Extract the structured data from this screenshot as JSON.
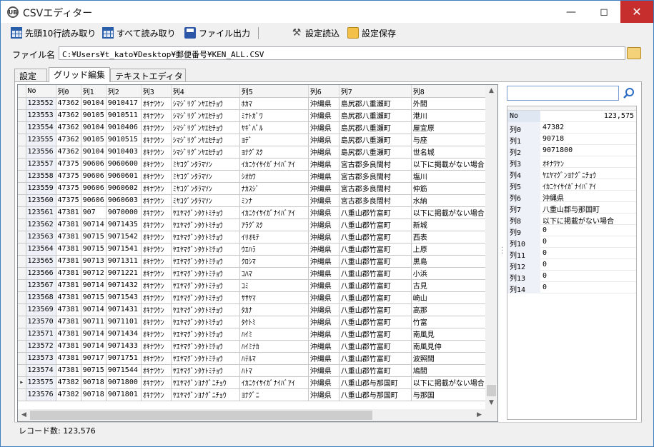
{
  "window": {
    "title": "CSVエディター",
    "icon_text": "UB"
  },
  "toolbar": {
    "read_head_label": "先頭10行読み取り",
    "read_all_label": "すべて読み取り",
    "file_output_label": "ファイル出力",
    "load_settings_label": "設定読込",
    "save_settings_label": "設定保存"
  },
  "file": {
    "label": "ファイル名",
    "path": "C:¥Users¥t_kato¥Desktop¥郵便番号¥KEN_ALL.CSV"
  },
  "tabs": [
    {
      "label": "設定",
      "active": false
    },
    {
      "label": "グリッド編集",
      "active": true
    },
    {
      "label": "テキストエディタ",
      "active": false
    }
  ],
  "grid": {
    "columns": [
      "No",
      "列0",
      "列1",
      "列2",
      "列3",
      "列4",
      "列5",
      "列6",
      "列7",
      "列8"
    ],
    "rows": [
      [
        "123552",
        "47362",
        "90104",
        "9010417",
        "ｵｷﾅﾜｹﾝ",
        "ｼﾏｼﾞﾘｸﾞﾝﾔｴｾﾁｮｳ",
        "ﾎｶﾏ",
        "沖縄県",
        "島尻郡八重瀬町",
        "外間"
      ],
      [
        "123553",
        "47362",
        "90105",
        "9010511",
        "ｵｷﾅﾜｹﾝ",
        "ｼﾏｼﾞﾘｸﾞﾝﾔｴｾﾁｮｳ",
        "ﾐﾅﾄｶﾞﾜ",
        "沖縄県",
        "島尻郡八重瀬町",
        "港川"
      ],
      [
        "123554",
        "47362",
        "90104",
        "9010406",
        "ｵｷﾅﾜｹﾝ",
        "ｼﾏｼﾞﾘｸﾞﾝﾔｴｾﾁｮｳ",
        "ﾔｷﾞﾊﾞﾙ",
        "沖縄県",
        "島尻郡八重瀬町",
        "屋宜原"
      ],
      [
        "123555",
        "47362",
        "90105",
        "9010515",
        "ｵｷﾅﾜｹﾝ",
        "ｼﾏｼﾞﾘｸﾞﾝﾔｴｾﾁｮｳ",
        "ﾖﾃﾞ",
        "沖縄県",
        "島尻郡八重瀬町",
        "与座"
      ],
      [
        "123556",
        "47362",
        "90104",
        "9010403",
        "ｵｷﾅﾜｹﾝ",
        "ｼﾏｼﾞﾘｸﾞﾝﾔｴｾﾁｮｳ",
        "ﾖﾅｸﾞｽｸ",
        "沖縄県",
        "島尻郡八重瀬町",
        "世名城"
      ],
      [
        "123557",
        "47375",
        "90606",
        "9060600",
        "ｵｷﾅﾜｹﾝ",
        "ﾐﾔｺｸﾞﾝﾀﾗﾏｿﾝ",
        "ｲｶﾆｹｲｻｲｶﾞﾅｲﾊﾞｱｲ",
        "沖縄県",
        "宮古郡多良間村",
        "以下に掲載がない場合"
      ],
      [
        "123558",
        "47375",
        "90606",
        "9060601",
        "ｵｷﾅﾜｹﾝ",
        "ﾐﾔｺｸﾞﾝﾀﾗﾏｿﾝ",
        "ｼｵｶﾜ",
        "沖縄県",
        "宮古郡多良間村",
        "塩川"
      ],
      [
        "123559",
        "47375",
        "90606",
        "9060602",
        "ｵｷﾅﾜｹﾝ",
        "ﾐﾔｺｸﾞﾝﾀﾗﾏｿﾝ",
        "ﾅｶｽｼﾞ",
        "沖縄県",
        "宮古郡多良間村",
        "仲筋"
      ],
      [
        "123560",
        "47375",
        "90606",
        "9060603",
        "ｵｷﾅﾜｹﾝ",
        "ﾐﾔｺｸﾞﾝﾀﾗﾏｿﾝ",
        "ﾐﾝﾅ",
        "沖縄県",
        "宮古郡多良間村",
        "水納"
      ],
      [
        "123561",
        "47381",
        "907",
        "9070000",
        "ｵｷﾅﾜｹﾝ",
        "ﾔｴﾔﾏｸﾞﾝﾀｹﾄﾐﾁｮｳ",
        "ｲｶﾆｹｲｻｲｶﾞﾅｲﾊﾞｱｲ",
        "沖縄県",
        "八重山郡竹富町",
        "以下に掲載がない場合"
      ],
      [
        "123562",
        "47381",
        "90714",
        "9071435",
        "ｵｷﾅﾜｹﾝ",
        "ﾔｴﾔﾏｸﾞﾝﾀｹﾄﾐﾁｮｳ",
        "ｱﾗｸﾞｽｸ",
        "沖縄県",
        "八重山郡竹富町",
        "新城"
      ],
      [
        "123563",
        "47381",
        "90715",
        "9071542",
        "ｵｷﾅﾜｹﾝ",
        "ﾔｴﾔﾏｸﾞﾝﾀｹﾄﾐﾁｮｳ",
        "ｲﾘｵﾓﾃ",
        "沖縄県",
        "八重山郡竹富町",
        "西表"
      ],
      [
        "123564",
        "47381",
        "90715",
        "9071541",
        "ｵｷﾅﾜｹﾝ",
        "ﾔｴﾔﾏｸﾞﾝﾀｹﾄﾐﾁｮｳ",
        "ｳｴﾊﾗ",
        "沖縄県",
        "八重山郡竹富町",
        "上原"
      ],
      [
        "123565",
        "47381",
        "90713",
        "9071311",
        "ｵｷﾅﾜｹﾝ",
        "ﾔｴﾔﾏｸﾞﾝﾀｹﾄﾐﾁｮｳ",
        "ｸﾛｼﾏ",
        "沖縄県",
        "八重山郡竹富町",
        "黒島"
      ],
      [
        "123566",
        "47381",
        "90712",
        "9071221",
        "ｵｷﾅﾜｹﾝ",
        "ﾔｴﾔﾏｸﾞﾝﾀｹﾄﾐﾁｮｳ",
        "ｺﾊﾏ",
        "沖縄県",
        "八重山郡竹富町",
        "小浜"
      ],
      [
        "123567",
        "47381",
        "90714",
        "9071432",
        "ｵｷﾅﾜｹﾝ",
        "ﾔｴﾔﾏｸﾞﾝﾀｹﾄﾐﾁｮｳ",
        "ｺﾐ",
        "沖縄県",
        "八重山郡竹富町",
        "古見"
      ],
      [
        "123568",
        "47381",
        "90715",
        "9071543",
        "ｵｷﾅﾜｹﾝ",
        "ﾔｴﾔﾏｸﾞﾝﾀｹﾄﾐﾁｮｳ",
        "ｻｻﾔﾏ",
        "沖縄県",
        "八重山郡竹富町",
        "崎山"
      ],
      [
        "123569",
        "47381",
        "90714",
        "9071431",
        "ｵｷﾅﾜｹﾝ",
        "ﾔｴﾔﾏｸﾞﾝﾀｹﾄﾐﾁｮｳ",
        "ﾀｶﾅ",
        "沖縄県",
        "八重山郡竹富町",
        "高那"
      ],
      [
        "123570",
        "47381",
        "90711",
        "9071101",
        "ｵｷﾅﾜｹﾝ",
        "ﾔｴﾔﾏｸﾞﾝﾀｹﾄﾐﾁｮｳ",
        "ﾀｹﾄﾐ",
        "沖縄県",
        "八重山郡竹富町",
        "竹富"
      ],
      [
        "123571",
        "47381",
        "90714",
        "9071434",
        "ｵｷﾅﾜｹﾝ",
        "ﾔｴﾔﾏｸﾞﾝﾀｹﾄﾐﾁｮｳ",
        "ﾊｲﾐ",
        "沖縄県",
        "八重山郡竹富町",
        "南風見"
      ],
      [
        "123572",
        "47381",
        "90714",
        "9071433",
        "ｵｷﾅﾜｹﾝ",
        "ﾔｴﾔﾏｸﾞﾝﾀｹﾄﾐﾁｮｳ",
        "ﾊｲﾐﾅｶ",
        "沖縄県",
        "八重山郡竹富町",
        "南風見仲"
      ],
      [
        "123573",
        "47381",
        "90717",
        "9071751",
        "ｵｷﾅﾜｹﾝ",
        "ﾔｴﾔﾏｸﾞﾝﾀｹﾄﾐﾁｮｳ",
        "ﾊﾃﾙﾏ",
        "沖縄県",
        "八重山郡竹富町",
        "波照間"
      ],
      [
        "123574",
        "47381",
        "90715",
        "9071544",
        "ｵｷﾅﾜｹﾝ",
        "ﾔｴﾔﾏｸﾞﾝﾀｹﾄﾐﾁｮｳ",
        "ﾊﾄﾏ",
        "沖縄県",
        "八重山郡竹富町",
        "鳩間"
      ],
      [
        "123575",
        "47382",
        "90718",
        "9071800",
        "ｵｷﾅﾜｹﾝ",
        "ﾔｴﾔﾏｸﾞﾝﾖﾅｸﾞﾆﾁｮｳ",
        "ｲｶﾆｹｲｻｲｶﾞﾅｲﾊﾞｱｲ",
        "沖縄県",
        "八重山郡与那国町",
        "以下に掲載がない場合"
      ],
      [
        "123576",
        "47382",
        "90718",
        "9071801",
        "ｵｷﾅﾜｹﾝ",
        "ﾔｴﾔﾏｸﾞﾝﾖﾅｸﾞﾆﾁｮｳ",
        "ﾖﾅｸﾞﾆ",
        "沖縄県",
        "八重山郡与那国町",
        "与那国"
      ]
    ],
    "selected_row": 23
  },
  "search": {
    "value": ""
  },
  "detail": {
    "rows": [
      {
        "key": "No",
        "value": "123,575"
      },
      {
        "key": "列0",
        "value": "47382"
      },
      {
        "key": "列1",
        "value": "90718"
      },
      {
        "key": "列2",
        "value": "9071800"
      },
      {
        "key": "列3",
        "value": "ｵｷﾅﾜｹﾝ"
      },
      {
        "key": "列4",
        "value": "ﾔｴﾔﾏｸﾞﾝﾖﾅｸﾞﾆﾁｮｳ"
      },
      {
        "key": "列5",
        "value": "ｲｶﾆｹｲｻｲｶﾞﾅｲﾊﾞｱｲ"
      },
      {
        "key": "列6",
        "value": "沖縄県"
      },
      {
        "key": "列7",
        "value": "八重山郡与那国町"
      },
      {
        "key": "列8",
        "value": "以下に掲載がない場合"
      },
      {
        "key": "列9",
        "value": "0"
      },
      {
        "key": "列10",
        "value": "0"
      },
      {
        "key": "列11",
        "value": "0"
      },
      {
        "key": "列12",
        "value": "0"
      },
      {
        "key": "列13",
        "value": "0"
      },
      {
        "key": "列14",
        "value": "0"
      }
    ]
  },
  "status": {
    "record_count": "レコード数: 123,576"
  },
  "colors": {
    "close_button": "#c62e2e",
    "row_header": "#f4f4f4",
    "no_column": "#eef2f8"
  }
}
